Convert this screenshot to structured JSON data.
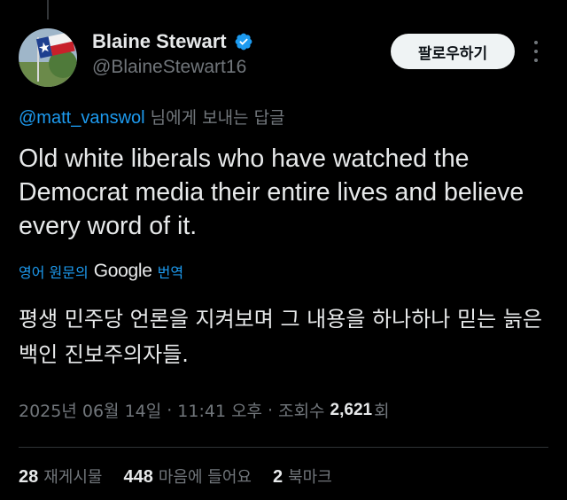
{
  "author": {
    "display_name": "Blaine Stewart",
    "handle": "@BlaineStewart16",
    "verified": true,
    "avatar_icon": "texas-flag-avatar"
  },
  "actions": {
    "follow_label": "팔로우하기"
  },
  "reply_context": {
    "mention": "@matt_vanswol",
    "suffix": " 님에게 보내는 답글"
  },
  "tweet": {
    "text": "Old white liberals who have watched the Democrat media their entire lives and believe every word of it."
  },
  "translation": {
    "prefix": "영어 원문의",
    "provider": "Google",
    "suffix": "번역",
    "text": "평생 민주당 언론을 지켜보며 그 내용을 하나하나 믿는 늙은 백인 진보주의자들."
  },
  "meta": {
    "date": "2025년 06월 14일",
    "separator": "·",
    "time": "11:41 오후",
    "views_label": "조회수",
    "views_count": "2,621",
    "views_unit": "회"
  },
  "stats": {
    "reposts_count": "28",
    "reposts_label": "재게시물",
    "likes_count": "448",
    "likes_label": "마음에 들어요",
    "bookmarks_count": "2",
    "bookmarks_label": "북마크"
  },
  "colors": {
    "background": "#000000",
    "text": "#e7e9ea",
    "secondary": "#71767b",
    "accent": "#1d9bf0",
    "verified": "#1d9bf0"
  }
}
